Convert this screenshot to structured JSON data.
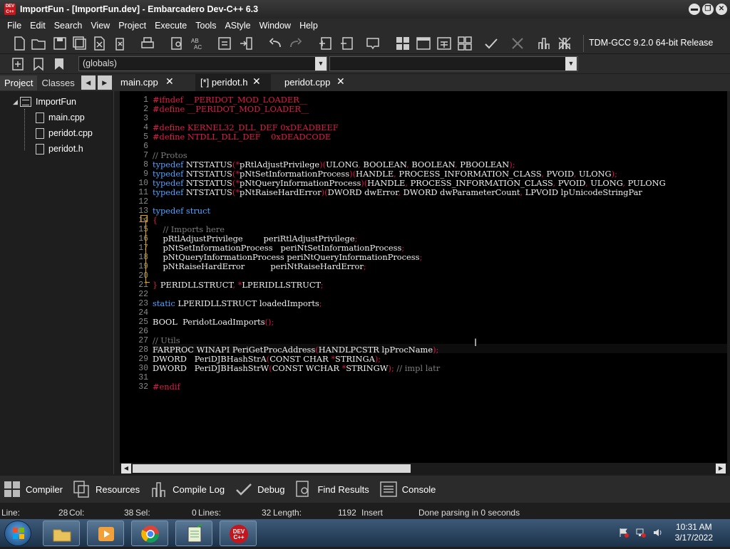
{
  "window": {
    "title": "ImportFun - [ImportFun.dev] - Embarcadero Dev-C++ 6.3",
    "app_icon_text": "DEV C++"
  },
  "window_buttons": {
    "minimize": "▬",
    "restore": "❐",
    "close": "✕"
  },
  "menu": [
    "File",
    "Edit",
    "Search",
    "View",
    "Project",
    "Execute",
    "Tools",
    "AStyle",
    "Window",
    "Help"
  ],
  "compiler": "TDM-GCC 9.2.0 64-bit Release",
  "scope_combo": "(globals)",
  "left_tabs": {
    "project": "Project",
    "classes": "Classes"
  },
  "project_tree": {
    "root": "ImportFun",
    "files": [
      "main.cpp",
      "peridot.cpp",
      "peridot.h"
    ]
  },
  "file_tabs": [
    {
      "label": "main.cpp",
      "active": false
    },
    {
      "label": "[*] peridot.h",
      "active": true
    },
    {
      "label": "peridot.cpp",
      "active": false
    }
  ],
  "code_lines": [
    [
      [
        "#ifndef __PERIDOT_MOD_LOADER__",
        "pp"
      ]
    ],
    [
      [
        "#define __PERIDOT_MOD_LOADER__",
        "pp"
      ]
    ],
    [],
    [
      [
        "#define KERNEL32_DLL_DEF 0xDEADBEEF",
        "pp"
      ]
    ],
    [
      [
        "#define NTDLL_DLL_DEF    0xDEADCODE",
        "pp"
      ]
    ],
    [],
    [
      [
        "// Protos",
        "cm"
      ]
    ],
    [
      [
        "typedef",
        "kw"
      ],
      [
        " NTSTATUS",
        "id"
      ],
      [
        "(*",
        "op"
      ],
      [
        "pRtlAdjustPrivilege",
        "id"
      ],
      [
        ")(",
        "op"
      ],
      [
        "ULONG",
        "id"
      ],
      [
        ", ",
        "op"
      ],
      [
        "BOOLEAN",
        "id"
      ],
      [
        ", ",
        "op"
      ],
      [
        "BOOLEAN",
        "id"
      ],
      [
        ", ",
        "op"
      ],
      [
        "PBOOLEAN",
        "id"
      ],
      [
        ");",
        "op"
      ]
    ],
    [
      [
        "typedef",
        "kw"
      ],
      [
        " NTSTATUS",
        "id"
      ],
      [
        "(*",
        "op"
      ],
      [
        "pNtSetInformationProcess",
        "id"
      ],
      [
        ")(",
        "op"
      ],
      [
        "HANDLE",
        "id"
      ],
      [
        ", ",
        "op"
      ],
      [
        "PROCESS_INFORMATION_CLASS",
        "id"
      ],
      [
        ", ",
        "op"
      ],
      [
        "PVOID",
        "id"
      ],
      [
        ", ",
        "op"
      ],
      [
        "ULONG",
        "id"
      ],
      [
        ");",
        "op"
      ]
    ],
    [
      [
        "typedef",
        "kw"
      ],
      [
        " NTSTATUS",
        "id"
      ],
      [
        "(*",
        "op"
      ],
      [
        "pNtQueryInformationProcess",
        "id"
      ],
      [
        ")(",
        "op"
      ],
      [
        "HANDLE",
        "id"
      ],
      [
        ", ",
        "op"
      ],
      [
        "PROCESS_INFORMATION_CLASS",
        "id"
      ],
      [
        ", ",
        "op"
      ],
      [
        "PVOID",
        "id"
      ],
      [
        ", ",
        "op"
      ],
      [
        "ULONG",
        "id"
      ],
      [
        ", ",
        "op"
      ],
      [
        "PULONG",
        "id"
      ]
    ],
    [
      [
        "typedef",
        "kw"
      ],
      [
        " NTSTATUS",
        "id"
      ],
      [
        "(*",
        "op"
      ],
      [
        "pNtRaiseHardError",
        "id"
      ],
      [
        ")(",
        "op"
      ],
      [
        "DWORD dwError",
        "id"
      ],
      [
        ", ",
        "op"
      ],
      [
        "DWORD dwParameterCount",
        "id"
      ],
      [
        ", ",
        "op"
      ],
      [
        "LPVOID lpUnicodeStringPar",
        "id"
      ]
    ],
    [],
    [
      [
        "typedef struct",
        "kw"
      ]
    ],
    [
      [
        "{",
        "op"
      ]
    ],
    [
      [
        "    // Imports here",
        "cm"
      ]
    ],
    [
      [
        "    pRtlAdjustPrivilege        periRtlAdjustPrivilege",
        "id"
      ],
      [
        ";",
        "op"
      ]
    ],
    [
      [
        "    pNtSetInformationProcess   periNtSetInformationProcess",
        "id"
      ],
      [
        ";",
        "op"
      ]
    ],
    [
      [
        "    pNtQueryInformationProcess periNtQueryInformationProcess",
        "id"
      ],
      [
        ";",
        "op"
      ]
    ],
    [
      [
        "    pNtRaiseHardError          periNtRaiseHardError",
        "id"
      ],
      [
        ";",
        "op"
      ]
    ],
    [],
    [
      [
        "}",
        "op"
      ],
      [
        " PERIDLLSTRUCT",
        "id"
      ],
      [
        ", ",
        "op"
      ],
      [
        "*",
        "op"
      ],
      [
        "LPERIDLLSTRUCT",
        "id"
      ],
      [
        ";",
        "op"
      ]
    ],
    [],
    [
      [
        "static",
        "kw"
      ],
      [
        " LPERIDLLSTRUCT loadedImports",
        "id"
      ],
      [
        ";",
        "op"
      ]
    ],
    [],
    [
      [
        "BOOL",
        "id"
      ],
      [
        "  PeridotLoadImports",
        "id"
      ],
      [
        "();",
        "op"
      ]
    ],
    [],
    [
      [
        "// Utils",
        "cm"
      ]
    ],
    [
      [
        "FARPROC WINAPI PeriGetProcAddress",
        "id"
      ],
      [
        "(",
        "op"
      ],
      [
        "HANDLPCSTR lpProcName",
        "id"
      ],
      [
        ");",
        "op"
      ]
    ],
    [
      [
        "DWORD   PeriDJBHashStrA",
        "id"
      ],
      [
        "(",
        "op"
      ],
      [
        "CONST CHAR ",
        "id"
      ],
      [
        "*",
        "op"
      ],
      [
        "STRINGA",
        "id"
      ],
      [
        ");",
        "op"
      ]
    ],
    [
      [
        "DWORD   PeriDJBHashStrW",
        "id"
      ],
      [
        "(",
        "op"
      ],
      [
        "CONST WCHAR ",
        "id"
      ],
      [
        "*",
        "op"
      ],
      [
        "STRINGW",
        "id"
      ],
      [
        ");",
        "op"
      ],
      [
        " // impl latr",
        "cm"
      ]
    ],
    [],
    [
      [
        "#endif",
        "pp"
      ]
    ]
  ],
  "colors": {
    "pp": "#e3194b",
    "kw": "#4fa3ff",
    "id": "#f0f0f0",
    "op": "#d9134a",
    "cm": "#7d7d7d",
    "gutter": "#888888",
    "fold": "#e8a400"
  },
  "bottom_tabs": [
    "Compiler",
    "Resources",
    "Compile Log",
    "Debug",
    "Find Results",
    "Console"
  ],
  "status": {
    "line_label": "Line:",
    "line_value": "28",
    "col_label": "Col:",
    "col_value": "38",
    "sel_label": "Sel:",
    "sel_value": "0",
    "lines_label": "Lines:",
    "lines_value": "32",
    "length_label": "Length:",
    "length_value": "1192",
    "mode": "Insert",
    "message": "Done parsing in 0 seconds"
  },
  "taskbar": {
    "apps": [
      "file-explorer",
      "media-player",
      "chrome",
      "notepad",
      "devcpp"
    ],
    "devcpp_label": "DEV C++",
    "time": "10:31 AM",
    "date": "3/17/2022"
  }
}
